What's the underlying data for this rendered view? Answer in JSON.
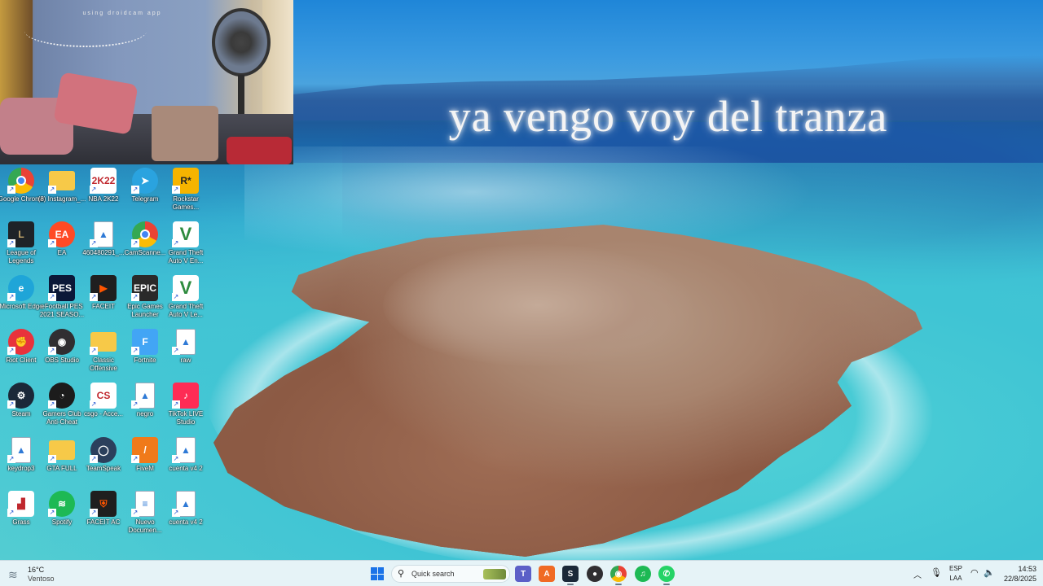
{
  "wallpaper": {
    "overlay_text": "ya vengo voy del tranza"
  },
  "webcam": {
    "caption": "using droidcam app"
  },
  "desktop_icons": [
    {
      "label": "Google Chrome",
      "icon": "chrome-icon",
      "color": "#ffffff"
    },
    {
      "label": "(8) Instagram_...",
      "icon": "folder-icon",
      "color": "#f7c948"
    },
    {
      "label": "NBA 2K22",
      "icon": "nba2k22-icon",
      "color": "#ffffff"
    },
    {
      "label": "Telegram",
      "icon": "telegram-icon",
      "color": "#2aa3df"
    },
    {
      "label": "Rockstar Games...",
      "icon": "rockstar-icon",
      "color": "#f6b400"
    },
    {
      "label": "League of Legends",
      "icon": "league-of-legends-icon",
      "color": "#1e2328"
    },
    {
      "label": "EA",
      "icon": "ea-icon",
      "color": "#ff4a25"
    },
    {
      "label": "460480291_...",
      "icon": "image-file-icon",
      "color": "#ffffff"
    },
    {
      "label": "CamScanne...",
      "icon": "chrome-icon",
      "color": "#ffffff"
    },
    {
      "label": "Grand Theft Auto V En...",
      "icon": "gta-v-icon",
      "color": "#ffffff"
    },
    {
      "label": "Microsoft Edge",
      "icon": "edge-icon",
      "color": "#1fa5d8"
    },
    {
      "label": "eFootball PES 2021 SEASO...",
      "icon": "efootball-icon",
      "color": "#0b1838"
    },
    {
      "label": "FACEIT",
      "icon": "faceit-icon",
      "color": "#1f1f1f"
    },
    {
      "label": "Epic Games Launcher",
      "icon": "epic-games-icon",
      "color": "#2a2a2a"
    },
    {
      "label": "Grand Theft Auto V Le...",
      "icon": "gta-v-icon",
      "color": "#ffffff"
    },
    {
      "label": "Riot Client",
      "icon": "riot-client-icon",
      "color": "#e8323c"
    },
    {
      "label": "OBS Studio",
      "icon": "obs-icon",
      "color": "#302e31"
    },
    {
      "label": "Classic Offensive",
      "icon": "folder-icon",
      "color": "#f7c948"
    },
    {
      "label": "Fortnite",
      "icon": "fortnite-icon",
      "color": "#42a5f5"
    },
    {
      "label": "raw",
      "icon": "image-file-icon",
      "color": "#ffffff"
    },
    {
      "label": "Steam",
      "icon": "steam-icon",
      "color": "#1b2838"
    },
    {
      "label": "Gamers Club Anti-Cheat",
      "icon": "gamers-club-icon",
      "color": "#1c1c1c"
    },
    {
      "label": "csgo - Acce...",
      "icon": "csgo-icon",
      "color": "#ffffff"
    },
    {
      "label": "negro",
      "icon": "image-file-icon",
      "color": "#ffffff"
    },
    {
      "label": "TikTok LIVE Studio",
      "icon": "tiktok-live-icon",
      "color": "#fe2c55"
    },
    {
      "label": "keydrop3",
      "icon": "image-file-icon",
      "color": "#ffffff"
    },
    {
      "label": "GTA FULL",
      "icon": "folder-icon",
      "color": "#f7c948"
    },
    {
      "label": "TeamSpeak",
      "icon": "teamspeak-icon",
      "color": "#2b3f5c"
    },
    {
      "label": "FiveM",
      "icon": "fivem-icon",
      "color": "#f07a1a"
    },
    {
      "label": "cuenta v4 2",
      "icon": "image-file-icon",
      "color": "#ffffff"
    },
    {
      "label": "Grass",
      "icon": "grass-icon",
      "color": "#ffffff"
    },
    {
      "label": "Spotify",
      "icon": "spotify-icon",
      "color": "#1db954"
    },
    {
      "label": "FACEIT AC",
      "icon": "faceit-ac-icon",
      "color": "#1f1f1f"
    },
    {
      "label": "Nuevo Documen...",
      "icon": "text-document-icon",
      "color": "#ffffff"
    },
    {
      "label": "cuenta v4 2",
      "icon": "image-file-icon",
      "color": "#ffffff"
    }
  ],
  "taskbar": {
    "weather": {
      "temp": "16°C",
      "condition": "Ventoso",
      "icon": "wind-icon"
    },
    "search_placeholder": "Quick search",
    "pinned_apps": [
      {
        "name": "teams",
        "icon": "teams-icon",
        "color": "#5b5fc7",
        "glyph": "T"
      },
      {
        "name": "app-a",
        "icon": "a-logo-icon",
        "color": "#f06a24",
        "glyph": "A"
      },
      {
        "name": "steam",
        "icon": "steam-icon",
        "color": "#1b2838",
        "glyph": "S"
      },
      {
        "name": "obs",
        "icon": "obs-icon",
        "color": "#302e31",
        "glyph": "●"
      },
      {
        "name": "chrome",
        "icon": "chrome-icon",
        "color": "#e8453c",
        "glyph": "◉"
      },
      {
        "name": "spotify",
        "icon": "spotify-icon",
        "color": "#1db954",
        "glyph": "♫"
      },
      {
        "name": "whatsapp",
        "icon": "whatsapp-icon",
        "color": "#25d366",
        "glyph": "✆"
      }
    ],
    "language_top": "ESP",
    "language_bottom": "LAA",
    "time": "14:53",
    "date": "22/8/2025"
  }
}
